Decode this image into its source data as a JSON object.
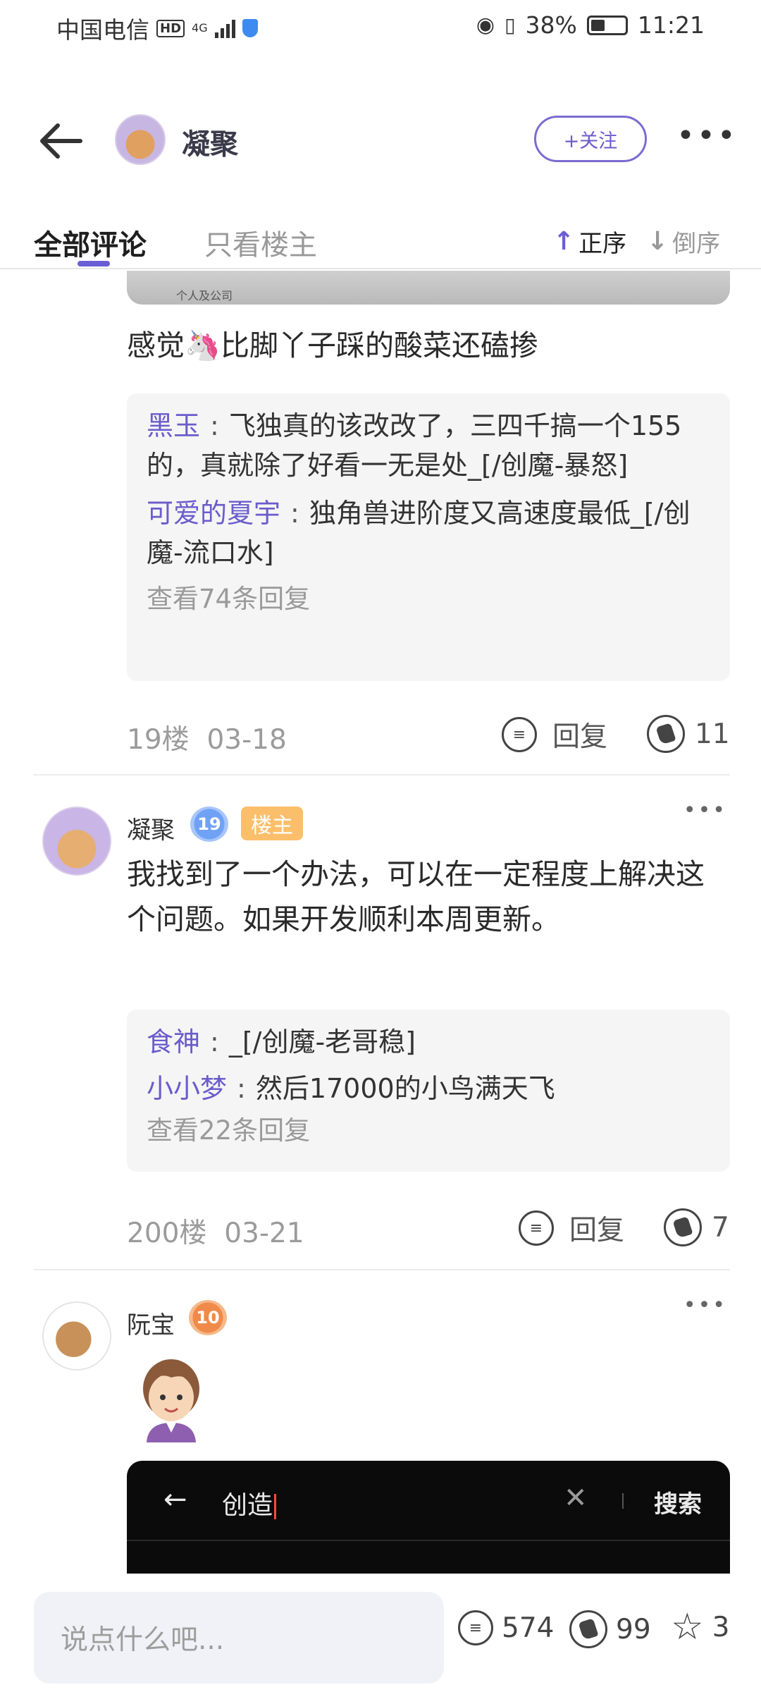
{
  "status_bar": {
    "carrier": "中国电信",
    "hd": "HD",
    "net": "4G",
    "battery": "38%",
    "time": "11:21"
  },
  "header": {
    "title": "凝聚",
    "follow_label": "+关注"
  },
  "tabs": {
    "all": "全部评论",
    "op_only": "只看楼主",
    "sort_asc": "正序",
    "sort_desc": "倒序"
  },
  "post_19": {
    "image_caption": "个人及公司",
    "text": "感觉🦄比脚丫子踩的酸菜还磕掺",
    "replies": [
      {
        "name": "黑玉",
        "text": "飞独真的该改改了，三四千搞一个155的，真就除了好看一无是处_[/创魔-暴怒]"
      },
      {
        "name": "可爱的夏宇",
        "text": "独角兽进阶度又高速度最低_[/创魔-流口水]"
      }
    ],
    "more_replies": "查看74条回复",
    "floor": "19楼",
    "date": "03-18",
    "reply_label": "回复",
    "likes": "11"
  },
  "post_200": {
    "author": "凝聚",
    "level": "19",
    "op_tag": "楼主",
    "text": "我找到了一个办法，可以在一定程度上解决这个问题。如果开发顺利本周更新。",
    "replies": [
      {
        "name": "食神",
        "text": "_[/创魔-老哥稳]"
      },
      {
        "name": "小小梦",
        "text": "然后17000的小鸟满天飞"
      }
    ],
    "more_replies": "查看22条回复",
    "floor": "200楼",
    "date": "03-21",
    "reply_label": "回复",
    "likes": "7"
  },
  "post_next": {
    "author": "阮宝",
    "level": "10",
    "search_text": "创造",
    "search_button": "搜索"
  },
  "bottom_bar": {
    "placeholder": "说点什么吧...",
    "comments": "574",
    "likes": "99",
    "favorites": "3"
  },
  "colors": {
    "accent": "#6b5ccc",
    "op_tag": "#fbbf6b"
  }
}
